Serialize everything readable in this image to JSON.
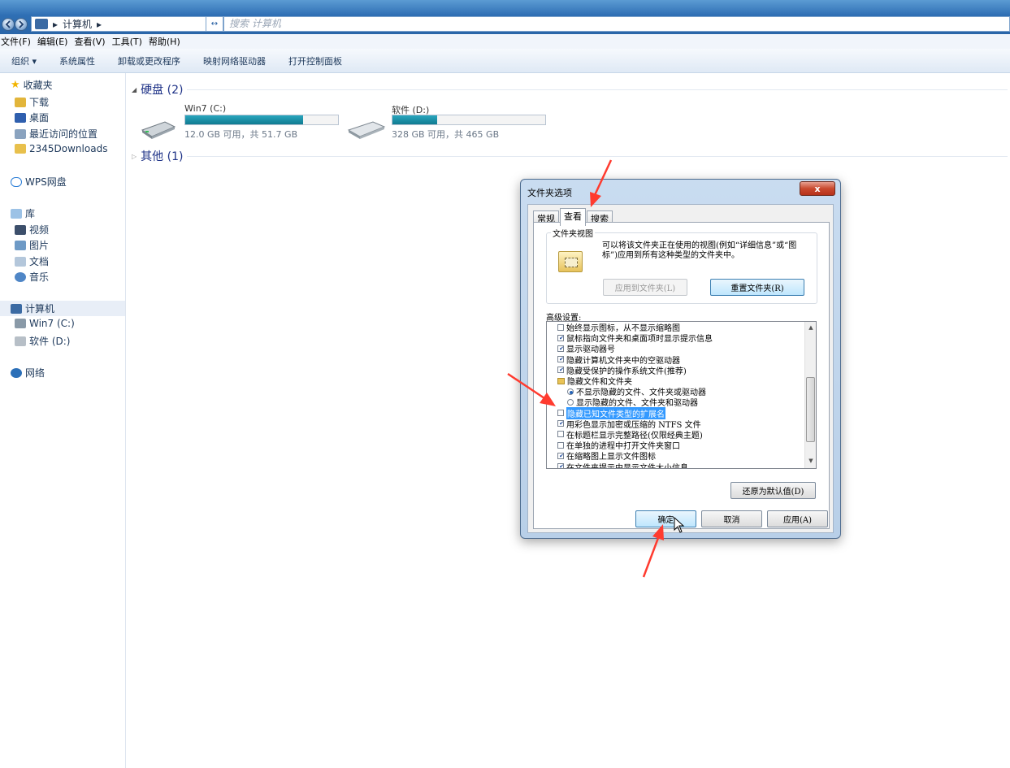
{
  "addressbar": {
    "path_separator": "▸",
    "path_item": "计算机",
    "search_placeholder": "搜索 计算机",
    "refresh": "↔"
  },
  "menubar": {
    "items": [
      "文件(F)",
      "编辑(E)",
      "查看(V)",
      "工具(T)",
      "帮助(H)"
    ]
  },
  "cmdbar": {
    "items": [
      "组织 ▾",
      "系统属性",
      "卸载或更改程序",
      "映射网络驱动器",
      "打开控制面板"
    ]
  },
  "navpane": {
    "favorites": "收藏夹",
    "downloads": "下载",
    "desktop": "桌面",
    "recent": "最近访问的位置",
    "downloads2345": "2345Downloads",
    "wps": "WPS网盘",
    "library": "库",
    "video": "视频",
    "pictures": "图片",
    "documents": "文档",
    "music": "音乐",
    "computer": "计算机",
    "drive_c": "Win7 (C:)",
    "drive_d": "软件 (D:)",
    "network": "网络"
  },
  "content": {
    "group_disks": "硬盘 (2)",
    "group_other": "其他 (1)",
    "drives": [
      {
        "name": "Win7 (C:)",
        "info": "12.0 GB 可用，共 51.7 GB",
        "used_fraction": 0.77
      },
      {
        "name": "软件 (D:)",
        "info": "328 GB 可用，共 465 GB",
        "used_fraction": 0.29
      }
    ]
  },
  "dialog": {
    "title": "文件夹选项",
    "close": "x",
    "tabs": [
      "常规",
      "查看",
      "搜索"
    ],
    "folder_views": {
      "legend": "文件夹视图",
      "text": "可以将该文件夹正在使用的视图(例如“详细信息”或“图标”)应用到所有这种类型的文件夹中。",
      "apply_btn": "应用到文件夹(L)",
      "reset_btn": "重置文件夹(R)"
    },
    "advanced_label": "高级设置:",
    "settings": [
      {
        "kind": "check",
        "checked": false,
        "label": "始终显示图标，从不显示缩略图"
      },
      {
        "kind": "check",
        "checked": true,
        "label": "鼠标指向文件夹和桌面项时显示提示信息"
      },
      {
        "kind": "check",
        "checked": true,
        "label": "显示驱动器号"
      },
      {
        "kind": "check",
        "checked": true,
        "label": "隐藏计算机文件夹中的空驱动器"
      },
      {
        "kind": "check",
        "checked": true,
        "label": "隐藏受保护的操作系统文件(推荐)"
      },
      {
        "kind": "folder",
        "label": "隐藏文件和文件夹"
      },
      {
        "kind": "radio",
        "checked": true,
        "label": "不显示隐藏的文件、文件夹或驱动器"
      },
      {
        "kind": "radio",
        "checked": false,
        "label": "显示隐藏的文件、文件夹和驱动器"
      },
      {
        "kind": "check",
        "checked": false,
        "highlighted": true,
        "label": "隐藏已知文件类型的扩展名"
      },
      {
        "kind": "check",
        "checked": true,
        "label": "用彩色显示加密或压缩的 NTFS 文件"
      },
      {
        "kind": "check",
        "checked": false,
        "label": "在标题栏显示完整路径(仅限经典主题)"
      },
      {
        "kind": "check",
        "checked": false,
        "label": "在单独的进程中打开文件夹窗口"
      },
      {
        "kind": "check",
        "checked": true,
        "label": "在缩略图上显示文件图标"
      },
      {
        "kind": "check",
        "checked": true,
        "label": "在文件夹提示中显示文件大小信息"
      }
    ],
    "restore_btn": "还原为默认值(D)",
    "ok_btn": "确定",
    "cancel_btn": "取消",
    "apply_btn": "应用(A)"
  },
  "colors": {
    "arrow": "#ff3b2f",
    "titlebar": "#2f6fb4",
    "highlight": "#3399ff"
  }
}
